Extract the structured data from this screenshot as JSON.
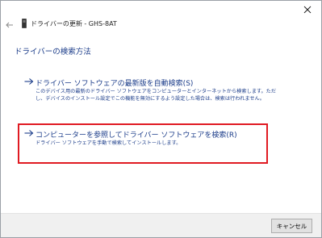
{
  "window": {
    "title": "ドライバーの更新 - GHS-8AT"
  },
  "heading": "ドライバーの検索方法",
  "options": [
    {
      "title": "ドライバー ソフトウェアの最新版を自動検索(S)",
      "description": "このデバイス用の最新のドライバー ソフトウェアをコンピューターとインターネットから検索します。ただし、デバイスのインストール設定でこの機能を無効にするよう設定した場合は、検索は行われません。"
    },
    {
      "title": "コンピューターを参照してドライバー ソフトウェアを検索(R)",
      "description": "ドライバー ソフトウェアを手動で検索してインストールします。"
    }
  ],
  "footer": {
    "cancel_label": "キャンセル"
  },
  "icons": {
    "close": "close-icon",
    "back": "back-arrow-icon",
    "device": "device-icon",
    "option_arrow": "arrow-right-icon"
  },
  "colors": {
    "link": "#1c3d8a",
    "highlight": "#e01a22",
    "footer_bg": "#f0f0f0"
  }
}
